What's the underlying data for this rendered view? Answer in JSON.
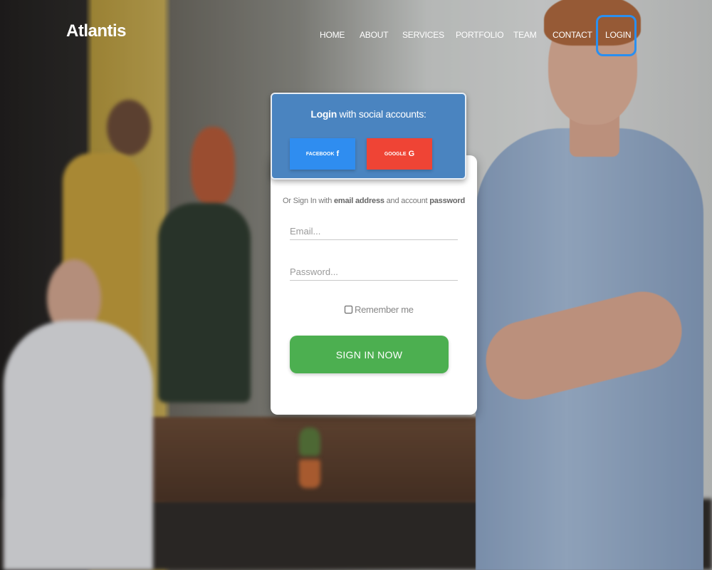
{
  "brand": "Atlantis",
  "nav": {
    "items": [
      "HOME",
      "ABOUT",
      "SERVICES",
      "PORTFOLIO",
      "TEAM",
      "CONTACT",
      "LOGIN"
    ],
    "active": "LOGIN"
  },
  "login_card": {
    "title_bold": "Login",
    "title_rest": " with social accounts:",
    "facebook_label": "FACEBOOK",
    "facebook_icon": "f",
    "google_label": "GOOGLE",
    "google_icon": "G",
    "sub_prefix": "Or Sign In with ",
    "sub_bold1": "email address",
    "sub_mid": " and account ",
    "sub_bold2": "password",
    "email_placeholder": "Email...",
    "password_placeholder": "Password...",
    "remember_label": "Remember me",
    "signin_label": "SIGN IN NOW"
  },
  "colors": {
    "header_blue": "#4a84c0",
    "facebook": "#2f8df0",
    "google": "#ef4435",
    "signin_green": "#4caf50",
    "active_outline": "#2a8ff0"
  }
}
